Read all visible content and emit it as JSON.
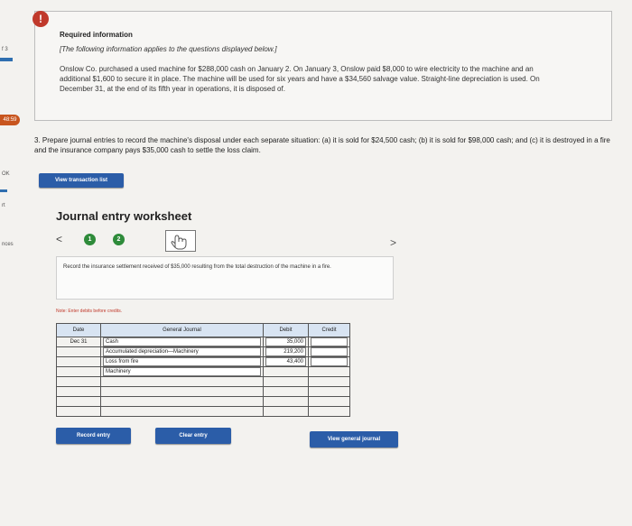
{
  "sidebar_fragments": [
    "f 3",
    "48:59",
    "OK",
    "rt",
    "nces"
  ],
  "info": {
    "alert_glyph": "!",
    "title": "Required information",
    "subtitle": "[The following information applies to the questions displayed below.]",
    "text": "Onslow Co. purchased a used machine for $288,000 cash on January 2. On January 3, Onslow paid $8,000 to wire electricity to the machine and an additional $1,600 to secure it in place. The machine will be used for six years and have a $34,560 salvage value. Straight-line depreciation is used. On December 31, at the end of its fifth year in operations, it is disposed of."
  },
  "question": "3. Prepare journal entries to record the machine's disposal under each separate situation: (a) it is sold for $24,500 cash; (b) it is sold for $98,000 cash; and (c) it is destroyed in a fire and the insurance company pays $35,000 cash to settle the loss claim.",
  "buttons": {
    "view_transaction_list": "View transaction list",
    "record_entry": "Record entry",
    "clear_entry": "Clear entry",
    "view_general_journal": "View general journal"
  },
  "worksheet": {
    "title": "Journal entry worksheet",
    "prev_glyph": "<",
    "next_glyph": ">",
    "steps": [
      "1",
      "2"
    ],
    "step_colors": [
      "#2e8b3a",
      "#2e8b3a"
    ],
    "instruction": "Record the insurance settlement received of $35,000 resulting from the total destruction of the machine in a fire.",
    "note": "Note: Enter debits before credits."
  },
  "journal": {
    "headers": {
      "date": "Date",
      "general_journal": "General Journal",
      "debit": "Debit",
      "credit": "Credit"
    },
    "rows": [
      {
        "date": "Dec 31",
        "account": "Cash",
        "debit": "35,000",
        "credit": ""
      },
      {
        "date": "",
        "account": "Accumulated depreciation—Machinery",
        "debit": "219,200",
        "credit": ""
      },
      {
        "date": "",
        "account": "Loss from fire",
        "debit": "43,400",
        "credit": ""
      },
      {
        "date": "",
        "account": "Machinery",
        "debit": "",
        "credit": ""
      },
      {
        "date": "",
        "account": "",
        "debit": "",
        "credit": ""
      },
      {
        "date": "",
        "account": "",
        "debit": "",
        "credit": ""
      },
      {
        "date": "",
        "account": "",
        "debit": "",
        "credit": ""
      },
      {
        "date": "",
        "account": "",
        "debit": "",
        "credit": ""
      }
    ]
  },
  "colors": {
    "primary_button": "#2b5da8",
    "header_fill": "#d8e4f2",
    "alert": "#c0392b"
  }
}
